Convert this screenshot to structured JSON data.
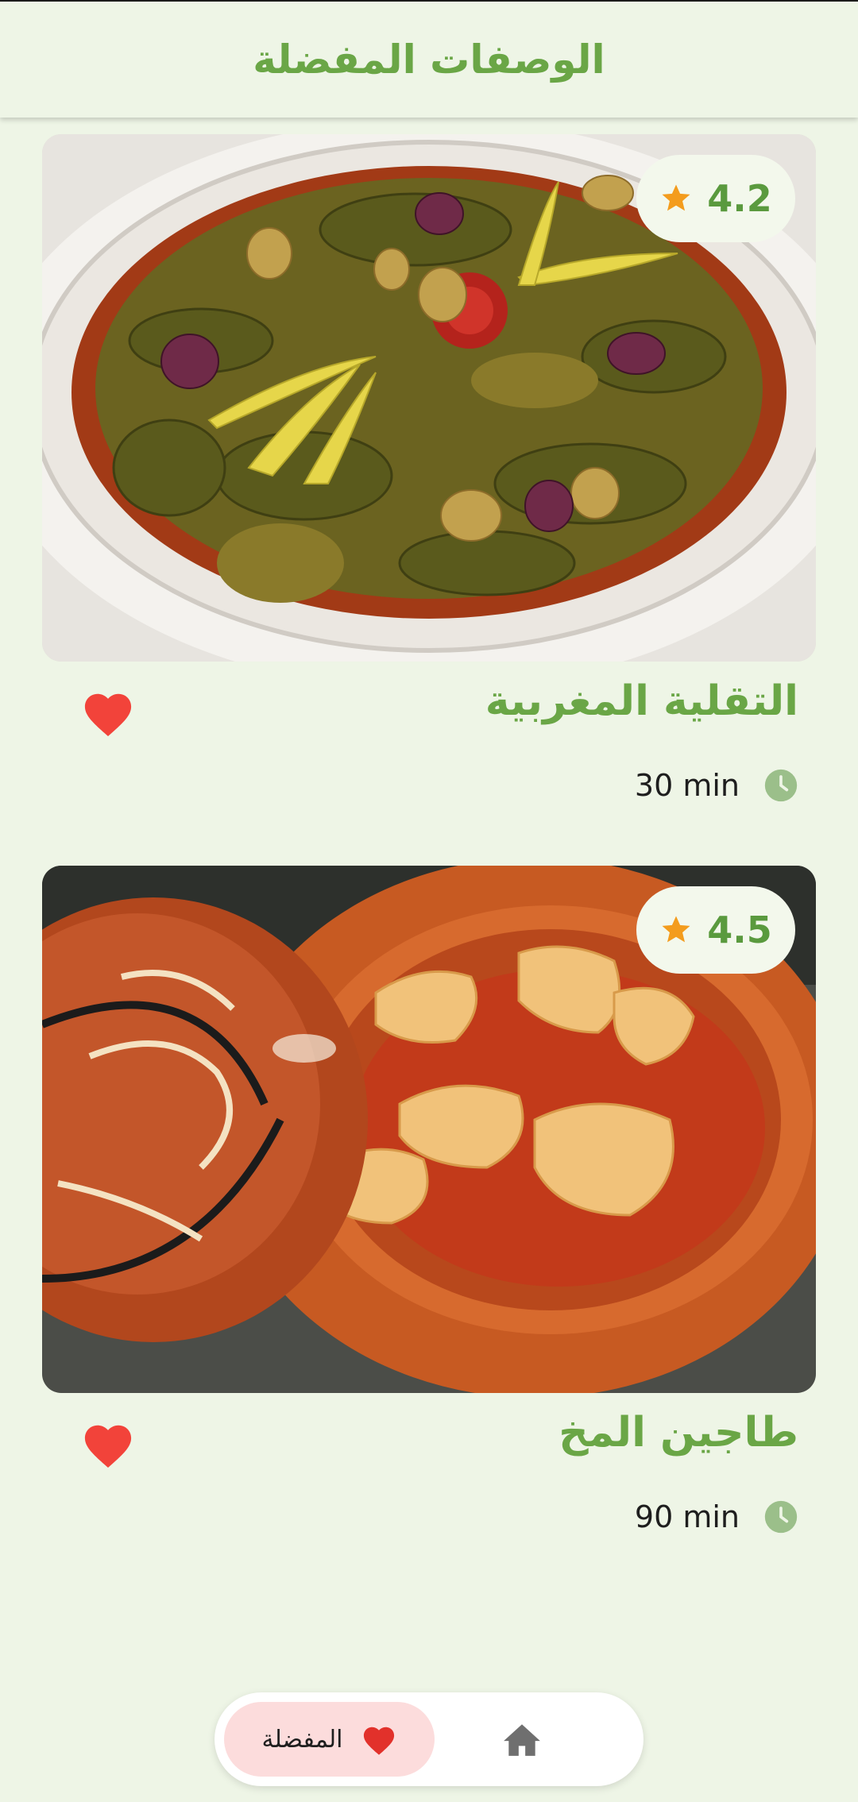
{
  "app_bar": {
    "title": "الوصفات المفضلة"
  },
  "recipes": [
    {
      "title": "التقلية المغربية",
      "rating": "4.2",
      "time": "30 min",
      "favorite": true,
      "image_icon": "tripe-dish-image"
    },
    {
      "title": "طاجين المخ",
      "rating": "4.5",
      "time": "90 min",
      "favorite": true,
      "image_icon": "tagine-image"
    }
  ],
  "bottom_nav": {
    "favorites_label": "المفضلة",
    "home_icon": "home-icon",
    "favorites_icon": "heart-icon"
  },
  "colors": {
    "background": "#eef5e6",
    "accent_green": "#6aa646",
    "heart_red": "#f2433a",
    "star_orange": "#f39c1d",
    "nav_active": "#fcdcdc"
  }
}
